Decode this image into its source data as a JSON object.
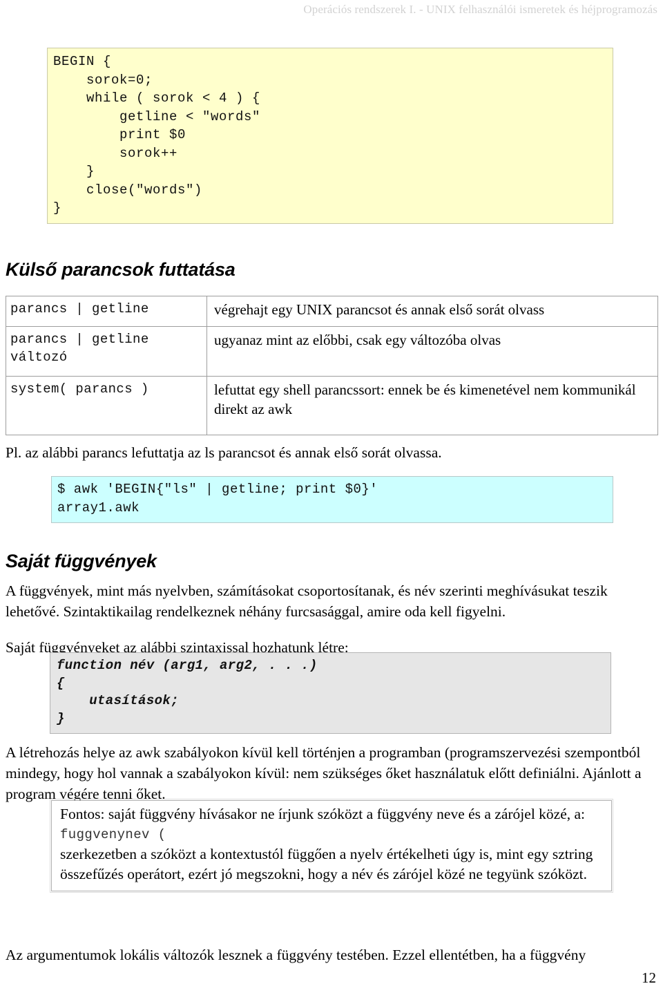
{
  "header": {
    "running_title": "Operációs rendszerek I. - UNIX felhasználói ismeretek és héjprogramozás"
  },
  "code_blocks": {
    "awk_begin": "BEGIN {\n    sorok=0;\n    while ( sorok < 4 ) {\n        getline < \"words\"\n        print $0\n        sorok++\n    }\n    close(\"words\")\n}",
    "awk_ls_example": "$ awk 'BEGIN{\"ls\" | getline; print $0}'\narray1.awk",
    "function_syntax": "function név (arg1, arg2, . . .)\n{\n    utasítások;\n}"
  },
  "headings": {
    "external_commands": "Külső parancsok futtatása",
    "own_functions": "Saját függvények"
  },
  "command_table": {
    "rows": [
      {
        "command": "parancs | getline",
        "description": "végrehajt egy UNIX parancsot és annak első sorát olvass"
      },
      {
        "command": "parancs | getline\nváltozó",
        "description": "ugyanaz mint az előbbi, csak egy változóba olvas"
      },
      {
        "command": "system( parancs )",
        "description": "lefuttat egy shell parancssort: ennek be és kimenetével nem kommunikál direkt az awk"
      }
    ]
  },
  "paragraphs": {
    "example_intro": "Pl. az alábbi parancs lefuttatja az ls parancsot és annak első sorát olvassa.",
    "functions_intro": "A függvények, mint más nyelvben, számításokat csoportosítanak, és név szerinti meghívásukat teszik lehetővé. Szintaktikailag rendelkeznek néhány furcsasággal, amire oda kell figyelni.",
    "syntax_intro": "Saját függvényeket az alábbi szintaxissal hozhatunk létre:",
    "creation_place": "A létrehozás helye az awk szabályokon kívül kell történjen a programban (programszervezési szempontból mindegy, hogy hol vannak a szabályokon kívül: nem szükséges őket használatuk előtt definiálni. Ajánlott a program végére tenni őket.",
    "arguments": "Az argumentumok lokális változók lesznek a függvény testében. Ezzel ellentétben, ha a függvény"
  },
  "note_box": {
    "line1": "Fontos: saját függvény hívásakor ne írjunk szóközt a függvény neve és a zárójel közé, a:",
    "mono": "fuggvenynev (",
    "line2": "szerkezetben a szóközt a kontextustól függően a nyelv értékelheti úgy is, mint egy sztring összefűzés operátort, ezért jó megszokni, hogy a név és zárójel közé ne tegyünk szóközt."
  },
  "footer": {
    "page_number": "12"
  }
}
